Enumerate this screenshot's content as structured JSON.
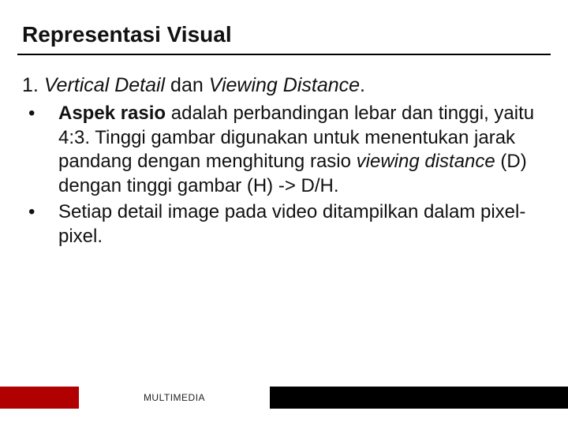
{
  "title": "Representasi Visual",
  "numbered": {
    "number": "1.",
    "part1_italic": "Vertical Detail",
    "part2_plain": " dan ",
    "part3_italic": "Viewing Distance",
    "part4_plain": "."
  },
  "bullets": [
    {
      "segments": [
        {
          "text": "Aspek rasio",
          "bold": true
        },
        {
          "text": " adalah perbandingan lebar dan tinggi, yaitu  4:3. Tinggi gambar digunakan untuk menentukan jarak pandang dengan menghitung rasio "
        },
        {
          "text": "viewing distance",
          "italic": true
        },
        {
          "text": " (D) dengan tinggi gambar (H) -> D/H."
        }
      ]
    },
    {
      "segments": [
        {
          "text": "Setiap detail image pada video ditampilkan dalam pixel-pixel."
        }
      ]
    }
  ],
  "footer_label": "MULTIMEDIA"
}
